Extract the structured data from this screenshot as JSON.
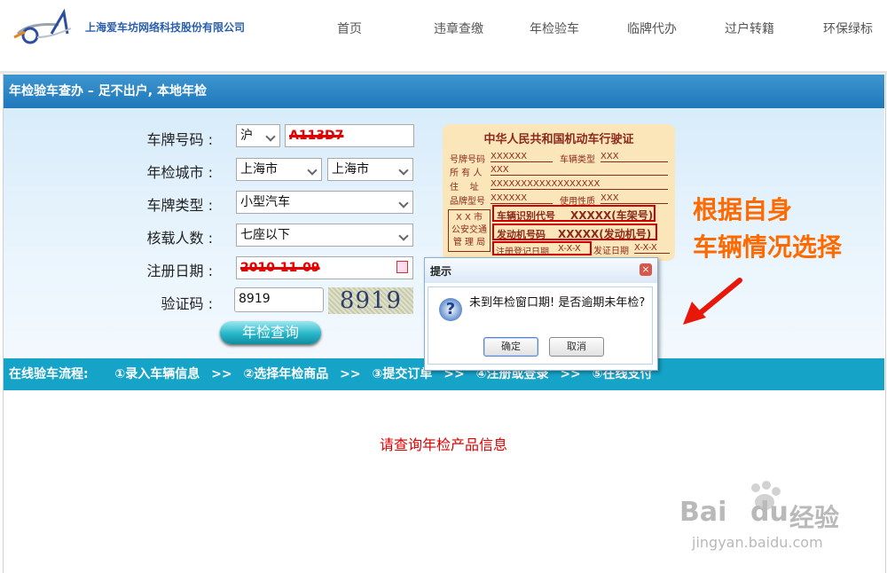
{
  "header": {
    "company": "上海爱车坊网络科技股份有限公司",
    "nav": [
      "首页",
      "违章查缴",
      "年检验车",
      "临牌代办",
      "过户转籍",
      "环保绿标"
    ]
  },
  "banner": {
    "title": "年检验车查办 – 足不出户, 本地年检"
  },
  "form": {
    "plate_label": "车牌号码 :",
    "plate_prefix": "沪",
    "plate_value": "A113D7",
    "city_label": "年检城市 :",
    "city_province": "上海市",
    "city_city": "上海市",
    "type_label": "车牌类型 :",
    "type_value": "小型汽车",
    "capacity_label": "核载人数 :",
    "capacity_value": "七座以下",
    "regdate_label": "注册日期 :",
    "regdate_value": "2010-11-09",
    "captcha_label": "验证码 :",
    "captcha_value": "8919",
    "captcha_image_text": "8919",
    "submit_label": "年检查询"
  },
  "license_card": {
    "title": "中华人民共和国机动车行驶证",
    "plate_no_label": "号牌号码",
    "plate_no": "XXXXXX",
    "vehicle_type_label": "车辆类型",
    "vehicle_type": "XXX",
    "owner_label": "所 有 人",
    "owner": "XXX",
    "address_label": "住    址",
    "address": "XXXXXXXXXXXXXXXXXX",
    "model_label": "品牌型号",
    "model": "XXXXXX",
    "usage_label": "使用性质",
    "usage": "XXX",
    "authority": [
      "X X 市",
      "公安交通",
      "管 理 局"
    ],
    "vin_label": "车辆识别代号",
    "vin": "XXXXX(车架号)",
    "engine_label": "发动机号码",
    "engine": "XXXXX(发动机号)",
    "regdate_label": "注册登记日期",
    "regdate": "X-X-X",
    "issue_label": "发证日期",
    "issue": "X-X-X"
  },
  "annotation": {
    "line1": "根据自身",
    "line2": "车辆情况选择"
  },
  "process": {
    "label": "在线验车流程:",
    "steps": [
      "①录入车辆信息",
      "②选择年检商品",
      "③提交订单",
      "④注册或登录",
      "⑤在线支付"
    ],
    "separator": ">>"
  },
  "result": {
    "message": "请查询年检产品信息"
  },
  "dialog": {
    "title": "提示",
    "close": "×",
    "icon": "?",
    "message": "未到年检窗口期! 是否逾期未年检?",
    "ok_label": "确定",
    "cancel_label": "取消"
  },
  "watermark": {
    "brand_bai": "Bai",
    "brand_du": "du",
    "brand_cn": "经验",
    "url": "jingyan.baidu.com"
  },
  "colors": {
    "banner": "#1f78ba",
    "process": "#16a3c8",
    "accent_orange": "#ff6a00",
    "error_red": "#e00000"
  }
}
